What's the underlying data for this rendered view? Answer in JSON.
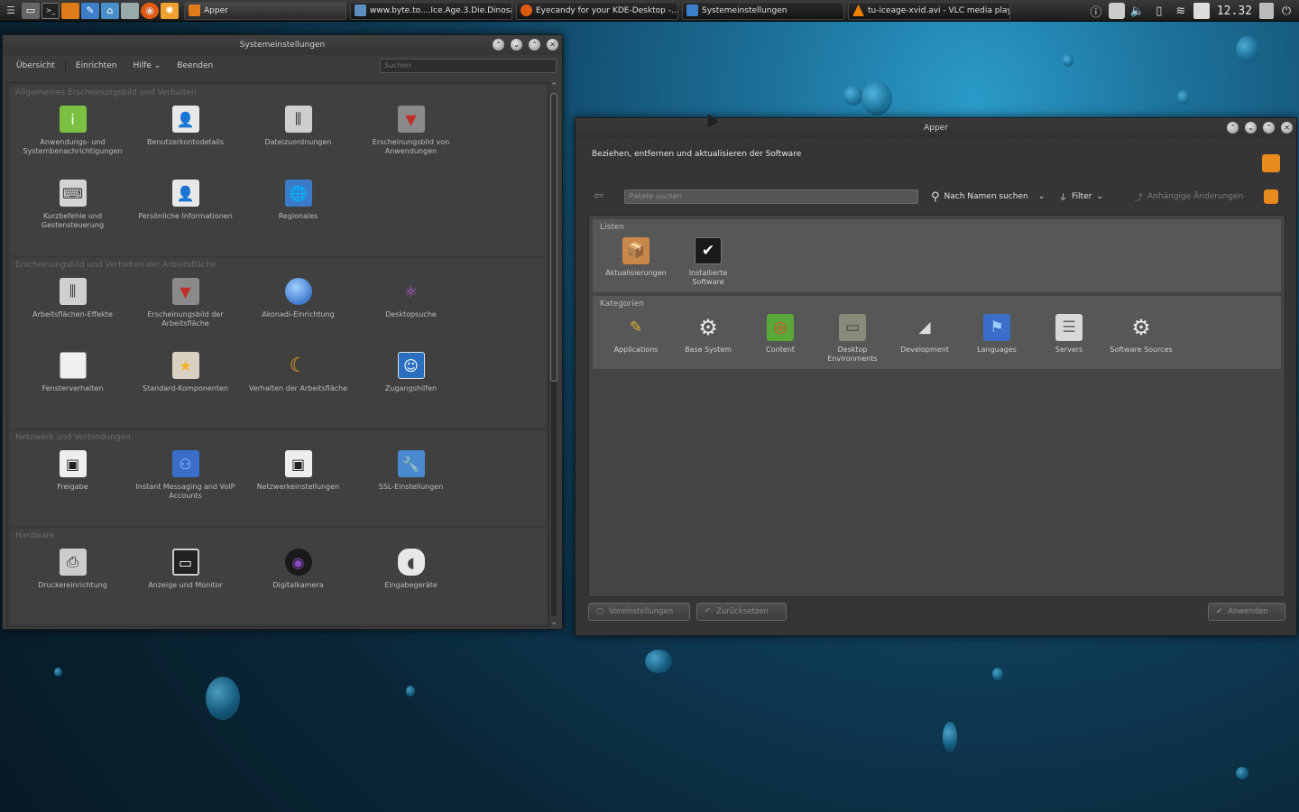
{
  "panel": {
    "tasks": [
      {
        "title": "Apper",
        "active": true
      },
      {
        "title": "www.byte.to....Ice.Age.3.Die.Dinosa..."
      },
      {
        "title": "Eyecandy for your KDE-Desktop -..."
      },
      {
        "title": "Systemeinstellungen"
      },
      {
        "title": "tu-iceage-xvid.avi - VLC media play..."
      }
    ],
    "clock": "12.32"
  },
  "sys": {
    "title": "Systemeinstellungen",
    "menu": [
      "Übersicht",
      "Einrichten",
      "Hilfe",
      "Beenden"
    ],
    "search_placeholder": "Suchen",
    "sections": [
      {
        "title": "Allgemeines Erscheinungsbild und Verhalten",
        "items": [
          "Anwendungs- und Systembenachrichtigungen",
          "Benutzerkontodetails",
          "Dateizuordnungen",
          "Erscheinungsbild von Anwendungen",
          "Kurzbefehle und Gestensteuerung",
          "Persönliche Informationen",
          "Regionales"
        ]
      },
      {
        "title": "Erscheinungsbild und Verhalten der Arbeitsfläche",
        "items": [
          "Arbeitsflächen-Effekte",
          "Erscheinungsbild der Arbeitsfläche",
          "Akonadi-Einrichtung",
          "Desktopsuche",
          "Fensterverhalten",
          "Standard-Komponenten",
          "Verhalten der Arbeitsfläche",
          "Zugangshilfen"
        ]
      },
      {
        "title": "Netzwerk und Verbindungen",
        "items": [
          "Freigabe",
          "Instant Messaging and VoIP Accounts",
          "Netzwerkeinstellungen",
          "SSL-Einstellungen"
        ]
      },
      {
        "title": "Hardware",
        "items": [
          "Druckereinrichtung",
          "Anzeige und Monitor",
          "Digitalkamera",
          "Eingabegeräte"
        ]
      }
    ]
  },
  "apper": {
    "title": "Apper",
    "subtitle": "Beziehen, entfernen und aktualisieren der Software",
    "search_placeholder": "Pakete suchen",
    "search_mode": "Nach Namen suchen",
    "filter": "Filter",
    "pending": "Anhängige Änderungen",
    "lists_title": "Listen",
    "lists": [
      "Aktualisierungen",
      "Installierte Software"
    ],
    "categories_title": "Kategorien",
    "categories": [
      "Applications",
      "Base System",
      "Content",
      "Desktop Environments",
      "Development",
      "Languages",
      "Servers",
      "Software Sources"
    ],
    "buttons": {
      "defaults": "Voreinstellungen",
      "reset": "Zurücksetzen",
      "apply": "Anwenden"
    }
  }
}
